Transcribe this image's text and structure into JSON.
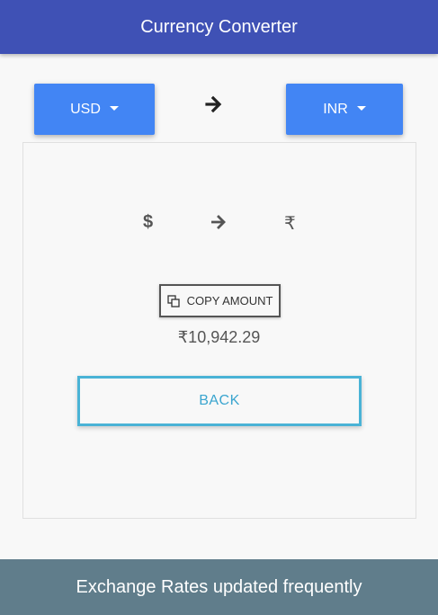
{
  "header": {
    "title": "Currency Converter"
  },
  "converter": {
    "from_currency": "USD",
    "to_currency": "INR",
    "from_symbol": "$",
    "to_symbol": "₹"
  },
  "result": {
    "copy_label": "COPY AMOUNT",
    "amount": "₹10,942.29",
    "back_label": "BACK"
  },
  "footer": {
    "text": "Exchange Rates updated frequently"
  },
  "colors": {
    "header_bg": "#3f51b5",
    "dropdown_bg": "#4285f4",
    "back_border": "#4ab3d6",
    "footer_bg": "#607d8b"
  },
  "icons": {
    "top_arrow": "arrow-right-icon",
    "mid_arrow": "arrow-right-icon",
    "copy": "copy-icon"
  }
}
